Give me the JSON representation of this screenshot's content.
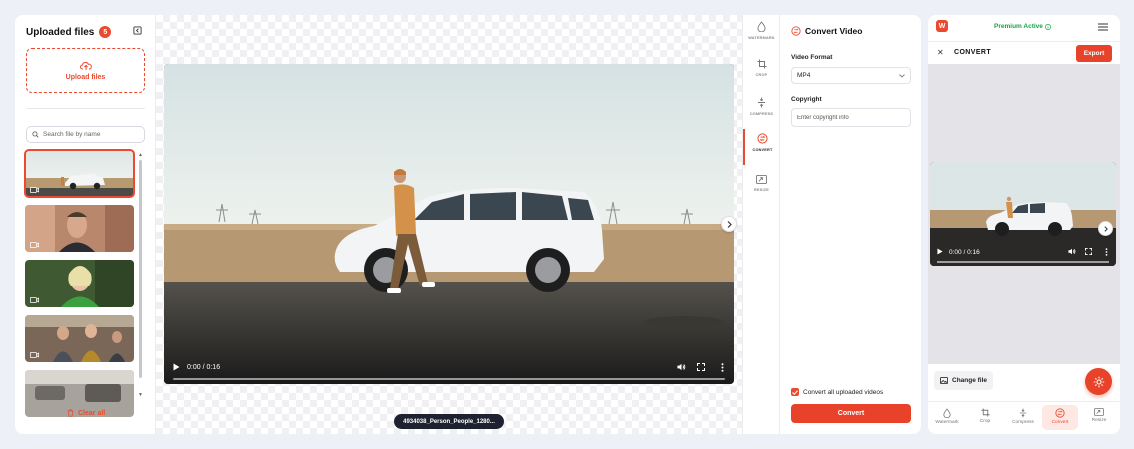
{
  "uploads": {
    "title": "Uploaded files",
    "count": "5",
    "upload_label": "Upload files",
    "search_placeholder": "Search file by name",
    "clear_label": "Clear all"
  },
  "player": {
    "time": "0:00 / 0:16",
    "filename": "4934038_Person_People_1280..."
  },
  "tools": [
    {
      "label": "WATERMARK",
      "icon": "droplet-icon"
    },
    {
      "label": "CROP",
      "icon": "crop-icon"
    },
    {
      "label": "COMPRESS",
      "icon": "compress-icon"
    },
    {
      "label": "CONVERT",
      "icon": "convert-icon"
    },
    {
      "label": "RESIZE",
      "icon": "resize-icon"
    }
  ],
  "convert": {
    "title": "Convert Video",
    "format_label": "Video Format",
    "format_value": "MP4",
    "copyright_label": "Copyright",
    "copyright_placeholder": "Enter copyright info",
    "checkbox_label": "Convert all uploaded videos",
    "button_label": "Convert"
  },
  "mobile": {
    "logo": "W",
    "premium": "Premium Active",
    "section_title": "CONVERT",
    "export_label": "Export",
    "time": "0:00 / 0:16",
    "change_file": "Change file",
    "tabs": [
      {
        "label": "Watermark"
      },
      {
        "label": "Crop"
      },
      {
        "label": "Compress"
      },
      {
        "label": "Convert"
      },
      {
        "label": "Resize"
      }
    ]
  },
  "colors": {
    "accent": "#ea4a2f",
    "premium": "#17a34a"
  }
}
